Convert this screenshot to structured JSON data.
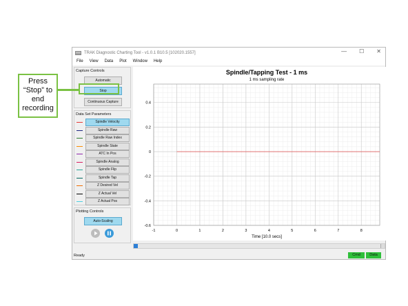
{
  "window": {
    "title": "TRAK Diagnostic Charting Tool - v1.0.1 B10.5 [102020.1557]",
    "controls": [
      "—",
      "☐",
      "✕"
    ]
  },
  "menu": [
    "File",
    "View",
    "Data",
    "Plot",
    "Window",
    "Help"
  ],
  "capture_controls": {
    "title": "Capture Controls",
    "automatic": "Automatic",
    "stop": "Stop",
    "continuous": "Continuous Capture"
  },
  "data_set_parameters": {
    "title": "Data Set Parameters",
    "items": [
      {
        "label": "Spindle Velocity",
        "color": "#e53935",
        "selected": true
      },
      {
        "label": "Spindle Raw",
        "color": "#1a237e"
      },
      {
        "label": "Spindle Raw Index",
        "color": "#2e7d32"
      },
      {
        "label": "Spindle State",
        "color": "#fb8c00"
      },
      {
        "label": "ATC In Pos",
        "color": "#8e24aa"
      },
      {
        "label": "Spindle Analog",
        "color": "#d81b60"
      },
      {
        "label": "Spindle Flip",
        "color": "#26a69a"
      },
      {
        "label": "Spindle Tap",
        "color": "#00695c"
      },
      {
        "label": "Z Desired Vel",
        "color": "#ef6c00"
      },
      {
        "label": "Z Actual Vel",
        "color": "#000000"
      },
      {
        "label": "Z Actual Pos",
        "color": "#4dd0e1"
      }
    ]
  },
  "plotting_controls": {
    "title": "Plotting Controls",
    "auto_scaling": "Auto-Scaling",
    "play_icon": "play-icon",
    "pause_icon": "pause-icon"
  },
  "chart_data": {
    "type": "line",
    "title": "Spindle/Tapping Test - 1 ms",
    "subtitle": "1 ms sampling rate",
    "xlabel": "Time [10.0 secs]",
    "ylabel": "",
    "xlim": [
      -1,
      8.8
    ],
    "ylim": [
      -0.6,
      0.55
    ],
    "x_ticks": [
      "-1",
      "0",
      "1",
      "2",
      "3",
      "4",
      "5",
      "6",
      "7",
      "8"
    ],
    "y_ticks": [
      "0.4",
      "0.2",
      "0",
      "-0.2",
      "-0.4",
      "-0.6"
    ],
    "grid": true,
    "series": [
      {
        "color": "#e06060",
        "x": [
          0,
          8.8
        ],
        "y": [
          0,
          0
        ]
      }
    ]
  },
  "status": {
    "text": "Ready",
    "cmd": "Cmd",
    "data": "Data",
    "indicator_color": "#2fbf3a"
  },
  "callout": {
    "text_line1": "Press",
    "text_line2": "“Stop” to",
    "text_line3": "end",
    "text_line4": "recording",
    "color": "#7ac143"
  }
}
